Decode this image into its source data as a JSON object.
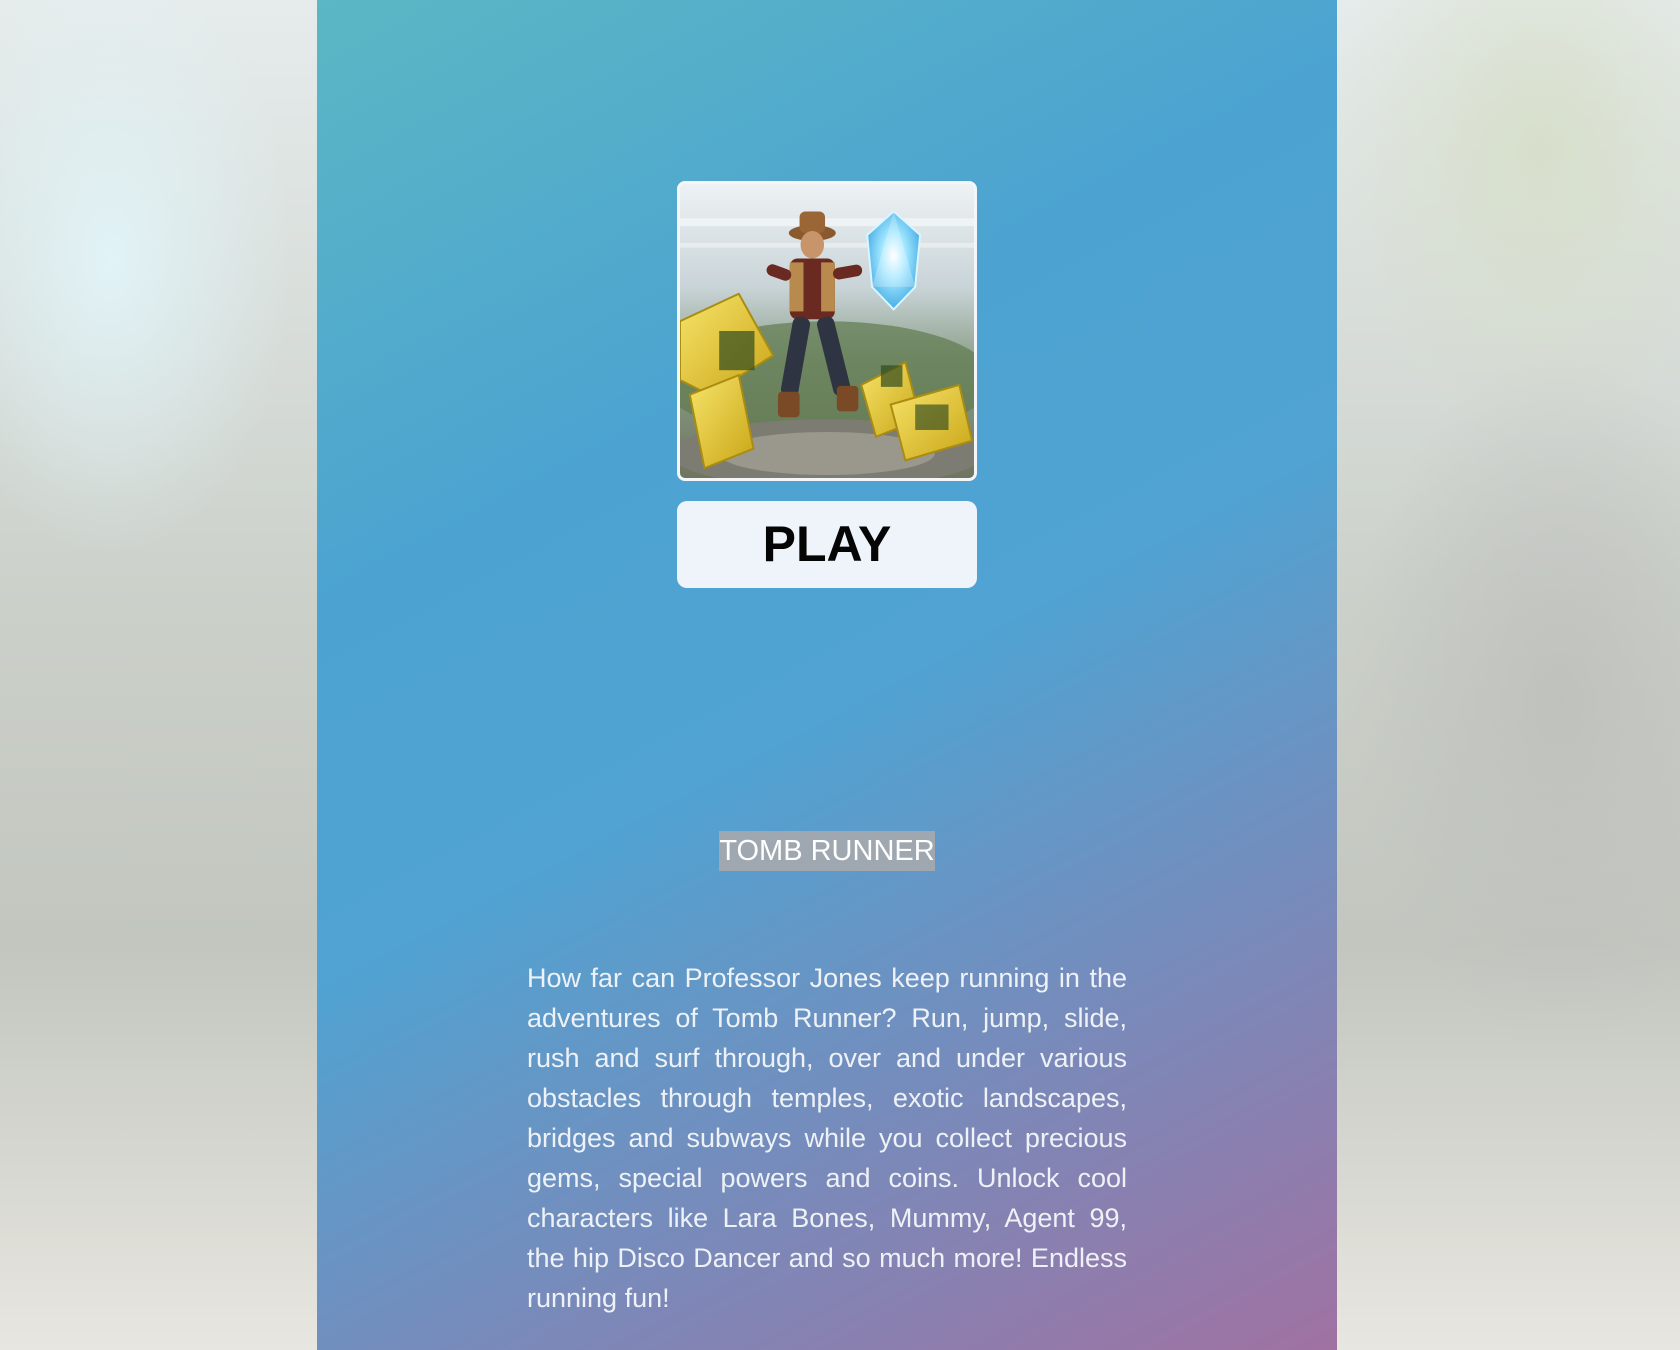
{
  "game": {
    "cover_alt": "Tomb Runner",
    "play_label": "PLAY",
    "title": "TOMB RUNNER",
    "description": "How far can Professor Jones keep running in the adventures of Tomb Runner? Run, jump, slide, rush and surf through, over and under various obstacles through temples, exotic landscapes, bridges and subways while you collect precious gems, special powers and coins. Unlock cool characters like Lara Bones, Mummy, Agent 99, the hip Disco Dancer and so much more! Endless running fun!"
  },
  "colors": {
    "panel_top": "#5bb7c4",
    "panel_mid": "#4ca3d1",
    "panel_bottom": "#a072a2",
    "button_bg": "#eef4fa",
    "title_highlight": "#9fa8b0"
  },
  "icons": {
    "cover": "game-cover-art"
  }
}
